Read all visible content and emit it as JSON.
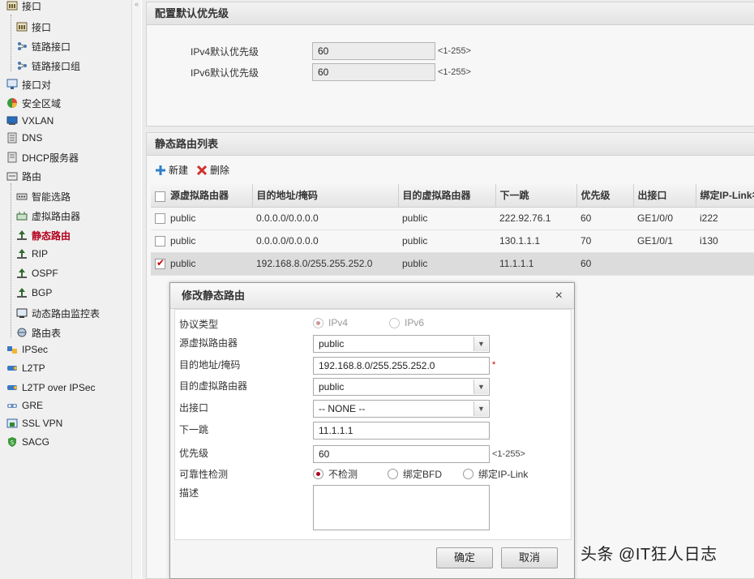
{
  "sidebar": {
    "items": [
      {
        "label": "接口",
        "icon": "interface-icon"
      },
      {
        "label": "接口",
        "icon": "interface-icon"
      },
      {
        "label": "链路接口",
        "icon": "link-interface-icon"
      },
      {
        "label": "链路接口组",
        "icon": "link-group-icon"
      },
      {
        "label": "接口对",
        "icon": "interface-pair-icon"
      },
      {
        "label": "安全区域",
        "icon": "security-zone-icon"
      },
      {
        "label": "VXLAN",
        "icon": "vxlan-icon"
      },
      {
        "label": "DNS",
        "icon": "dns-icon"
      },
      {
        "label": "DHCP服务器",
        "icon": "dhcp-icon"
      },
      {
        "label": "路由",
        "icon": "route-folder-icon"
      },
      {
        "label": "智能选路",
        "icon": "smart-route-icon"
      },
      {
        "label": "虚拟路由器",
        "icon": "virtual-router-icon"
      },
      {
        "label": "静态路由",
        "icon": "static-route-icon"
      },
      {
        "label": "RIP",
        "icon": "rip-icon"
      },
      {
        "label": "OSPF",
        "icon": "ospf-icon"
      },
      {
        "label": "BGP",
        "icon": "bgp-icon"
      },
      {
        "label": "动态路由监控表",
        "icon": "monitor-icon"
      },
      {
        "label": "路由表",
        "icon": "route-table-icon"
      },
      {
        "label": "IPSec",
        "icon": "ipsec-icon"
      },
      {
        "label": "L2TP",
        "icon": "l2tp-icon"
      },
      {
        "label": "L2TP over IPSec",
        "icon": "l2tp-ipsec-icon"
      },
      {
        "label": "GRE",
        "icon": "gre-icon"
      },
      {
        "label": "SSL VPN",
        "icon": "ssl-vpn-icon"
      },
      {
        "label": "SACG",
        "icon": "sacg-icon"
      }
    ],
    "active": "静态路由"
  },
  "default_priority": {
    "title": "配置默认优先级",
    "ipv4_label": "IPv4默认优先级",
    "ipv4_value": "60",
    "ipv4_hint": "<1-255>",
    "ipv6_label": "IPv6默认优先级",
    "ipv6_value": "60",
    "ipv6_hint": "<1-255>"
  },
  "route_list": {
    "title": "静态路由列表",
    "new_label": "新建",
    "delete_label": "删除",
    "columns": [
      "源虚拟路由器",
      "目的地址/掩码",
      "目的虚拟路由器",
      "下一跳",
      "优先级",
      "出接口",
      "绑定IP-Link名"
    ],
    "rows": [
      {
        "checked": false,
        "cells": [
          "public",
          "0.0.0.0/0.0.0.0",
          "public",
          "222.92.76.1",
          "60",
          "GE1/0/0",
          "i222"
        ]
      },
      {
        "checked": false,
        "cells": [
          "public",
          "0.0.0.0/0.0.0.0",
          "public",
          "130.1.1.1",
          "70",
          "GE1/0/1",
          "i130"
        ]
      },
      {
        "checked": true,
        "cells": [
          "public",
          "192.168.8.0/255.255.252.0",
          "public",
          "11.1.1.1",
          "60",
          "",
          ""
        ]
      }
    ]
  },
  "dialog": {
    "title": "修改静态路由",
    "close": "×",
    "protocol_label": "协议类型",
    "protocol_options": [
      "IPv4",
      "IPv6"
    ],
    "src_vr_label": "源虚拟路由器",
    "src_vr_value": "public",
    "dest_label": "目的地址/掩码",
    "dest_value": "192.168.8.0/255.255.252.0",
    "required_mark": "*",
    "dest_vr_label": "目的虚拟路由器",
    "dest_vr_value": "public",
    "out_if_label": "出接口",
    "out_if_value": "-- NONE --",
    "next_hop_label": "下一跳",
    "next_hop_value": "11.1.1.1",
    "priority_label": "优先级",
    "priority_value": "60",
    "priority_hint": "<1-255>",
    "reliability_label": "可靠性检测",
    "reliability_options": [
      "不检测",
      "绑定BFD",
      "绑定IP-Link"
    ],
    "desc_label": "描述",
    "ok_label": "确定",
    "cancel_label": "取消"
  },
  "watermark": "头条 @IT狂人日志",
  "colors": {
    "active": "#b3001b",
    "radio_selected": "#b00020"
  }
}
